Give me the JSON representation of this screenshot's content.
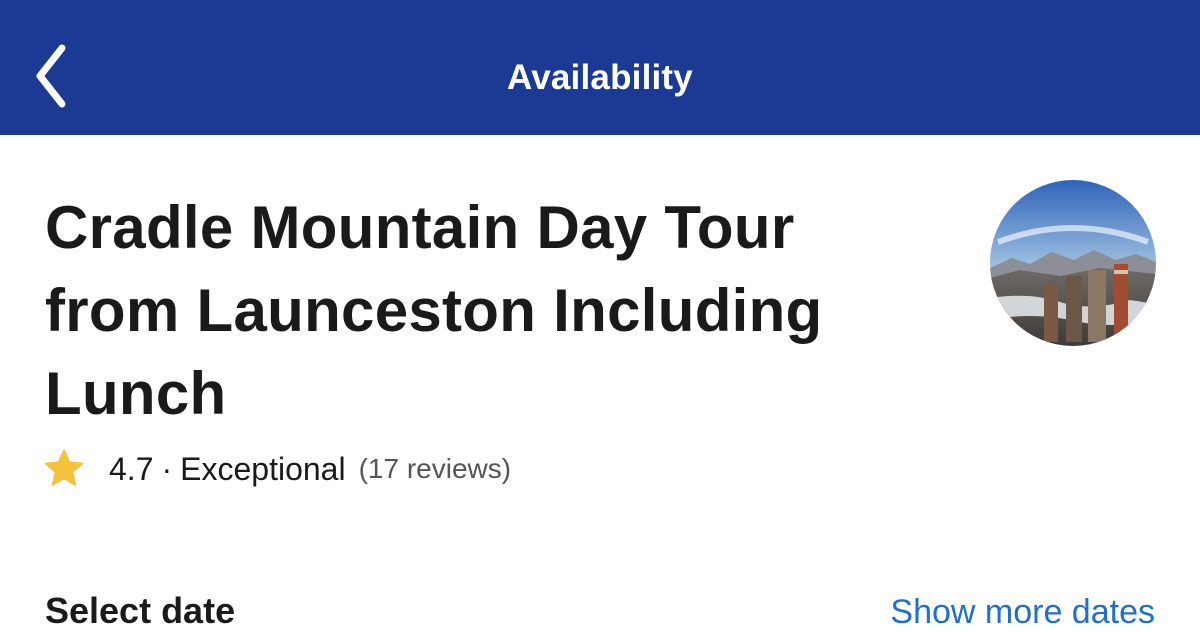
{
  "header": {
    "title": "Availability",
    "back_icon": "chevron-left-icon",
    "background_color": "#1a3a93"
  },
  "tour": {
    "title": "Cradle Mountain Day Tour from Launceston Including Lunch",
    "thumbnail": "tour-thumbnail-image"
  },
  "rating": {
    "star_icon": "star-icon",
    "star_color": "#f5c33b",
    "score": "4.7",
    "separator": "·",
    "label": "Exceptional",
    "reviews": "(17 reviews)"
  },
  "date_section": {
    "heading": "Select date",
    "show_more": "Show more dates",
    "link_color": "#1f6fd0"
  }
}
